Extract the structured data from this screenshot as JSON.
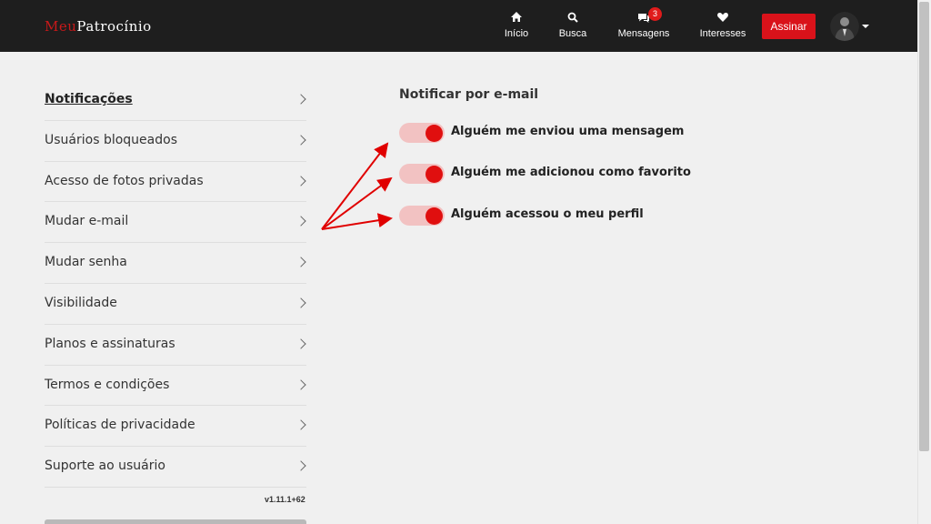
{
  "header": {
    "logo_part1": "Meu",
    "logo_part2": "Patrocínio",
    "nav": [
      {
        "label": "Início",
        "icon": "home-icon"
      },
      {
        "label": "Busca",
        "icon": "search-icon"
      },
      {
        "label": "Mensagens",
        "icon": "messages-icon",
        "badge": "3"
      },
      {
        "label": "Interesses",
        "icon": "heart-icon"
      }
    ],
    "subscribe_label": "Assinar"
  },
  "sidebar": {
    "items": [
      {
        "label": "Notificações",
        "active": true
      },
      {
        "label": "Usuários bloqueados"
      },
      {
        "label": "Acesso de fotos privadas"
      },
      {
        "label": "Mudar e-mail"
      },
      {
        "label": "Mudar senha"
      },
      {
        "label": "Visibilidade"
      },
      {
        "label": "Planos e assinaturas"
      },
      {
        "label": "Termos e condições"
      },
      {
        "label": "Políticas de privacidade"
      },
      {
        "label": "Suporte ao usuário"
      }
    ],
    "version": "v1.11.1+62"
  },
  "notifications": {
    "title": "Notificar por e-mail",
    "toggles": [
      {
        "label": "Alguém me enviou uma mensagem",
        "enabled": true
      },
      {
        "label": "Alguém me adicionou como favorito",
        "enabled": true
      },
      {
        "label": "Alguém acessou o meu perfil",
        "enabled": true
      }
    ]
  },
  "colors": {
    "header_bg": "#1e1e1e",
    "accent": "#d9121a",
    "toggle_track": "#f2c2c2",
    "toggle_knob": "#e00f0f",
    "annotation_arrow": "#e00000"
  }
}
